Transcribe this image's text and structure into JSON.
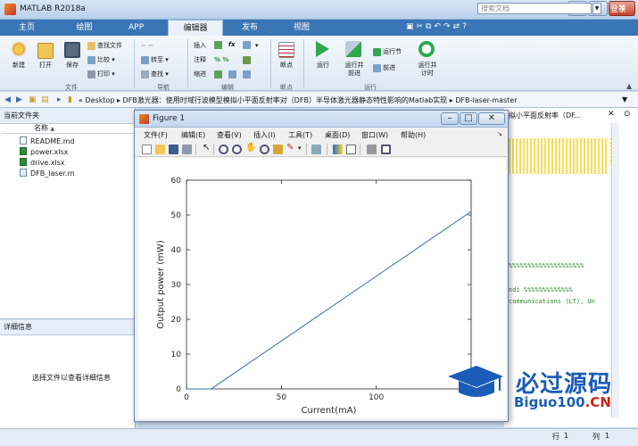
{
  "app": {
    "title": "MATLAB R2018a"
  },
  "tabs": [
    "主页",
    "绘图",
    "APP",
    "编辑器",
    "发布",
    "视图"
  ],
  "active_tab": "编辑器",
  "search": {
    "placeholder": "搜索文档"
  },
  "login": "登录",
  "ribbon": {
    "file": {
      "new": "新建",
      "open": "打开",
      "save": "保存",
      "find_files": "查找文件",
      "compare": "比较",
      "print": "打印",
      "group": "文件"
    },
    "nav": {
      "goto": "转至",
      "find": "查找",
      "group": "导航"
    },
    "edit": {
      "insert": "插入",
      "comment": "注释",
      "indent": "缩进",
      "fx": "fx",
      "group": "编辑"
    },
    "breakpoint": {
      "label": "断点",
      "group": "断点"
    },
    "run": {
      "run": "运行",
      "run_advance": "运行并\n前进",
      "run_section": "运行节",
      "advance": "前进",
      "run_time": "运行并\n计时",
      "group": "运行"
    }
  },
  "path": "« Desktop ▸ DFB激光器：使用时域行波模型模拟小平面反射率对（DFB）半导体激光器静态特性影响的Matlab实现 ▸ DFB-laser-master",
  "current_folder": {
    "title": "当前文件夹",
    "column": "名称",
    "sort": "▲",
    "files": [
      "README.md",
      "power.xlsx",
      "drive.xlsx",
      "DFB_laser.m"
    ]
  },
  "details": {
    "title": "详细信息",
    "hint": "选择文件以查看详细信息"
  },
  "editor": {
    "header": "拟小平面反射率（DF...",
    "lines": [
      "%%%%%%%%%%%%%%%%%%%%",
      "ndi   %%%%%%%%%%%%%",
      "communications (LT), Un"
    ]
  },
  "status": {
    "row_label": "行",
    "row": "1",
    "col_label": "列",
    "col": "1"
  },
  "figure": {
    "title": "Figure 1",
    "menu": [
      "文件(F)",
      "编辑(E)",
      "查看(V)",
      "插入(I)",
      "工具(T)",
      "桌面(D)",
      "窗口(W)",
      "帮助(H)"
    ]
  },
  "chart_data": {
    "type": "line",
    "xlabel": "Current(mA)",
    "ylabel": "Output power (mW)",
    "xlim": [
      0,
      150
    ],
    "ylim": [
      0,
      60
    ],
    "xticks": [
      0,
      50,
      100
    ],
    "yticks": [
      0,
      10,
      20,
      30,
      40,
      50,
      60
    ],
    "grid": false,
    "series": [
      {
        "x": [
          0,
          13,
          150
        ],
        "y": [
          0,
          0,
          51
        ],
        "color": "#2f6db5"
      }
    ]
  },
  "watermark": {
    "text1": "必过源码",
    "text2": "Biguo100",
    "text3": ".CN"
  }
}
